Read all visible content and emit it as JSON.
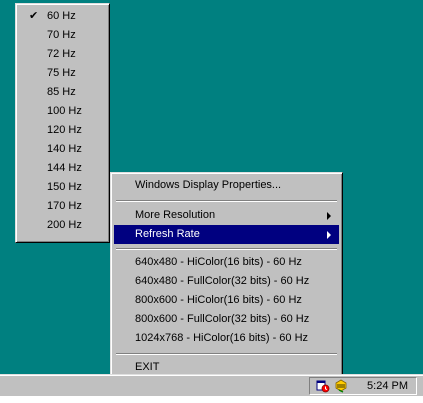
{
  "submenu": {
    "items": [
      {
        "label": "60 Hz",
        "checked": true
      },
      {
        "label": "70 Hz",
        "checked": false
      },
      {
        "label": "72 Hz",
        "checked": false
      },
      {
        "label": "75 Hz",
        "checked": false
      },
      {
        "label": "85 Hz",
        "checked": false
      },
      {
        "label": "100 Hz",
        "checked": false
      },
      {
        "label": "120 Hz",
        "checked": false
      },
      {
        "label": "140 Hz",
        "checked": false
      },
      {
        "label": "144 Hz",
        "checked": false
      },
      {
        "label": "150 Hz",
        "checked": false
      },
      {
        "label": "170 Hz",
        "checked": false
      },
      {
        "label": "200 Hz",
        "checked": false
      }
    ],
    "check_glyph": "✔"
  },
  "main_menu": {
    "display_properties": "Windows Display Properties...",
    "more_resolution": "More Resolution",
    "refresh_rate": "Refresh Rate",
    "modes": [
      "640x480 - HiColor(16 bits) - 60 Hz",
      "640x480 - FullColor(32 bits) - 60 Hz",
      "800x600 - HiColor(16 bits) - 60 Hz",
      "800x600 - FullColor(32 bits) - 60 Hz",
      "1024x768 - HiColor(16 bits) - 60 Hz"
    ],
    "exit": "EXIT"
  },
  "taskbar": {
    "clock": "5:24 PM",
    "tray_icons": [
      "schedule-alert-icon",
      "display-settings-icon"
    ]
  },
  "colors": {
    "desktop": "#008080",
    "menu_face": "#c0c0c0",
    "highlight": "#000080"
  }
}
